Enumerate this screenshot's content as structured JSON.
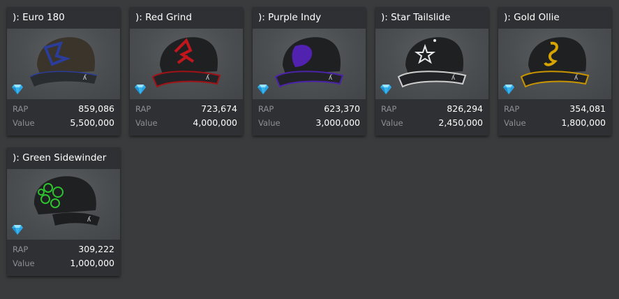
{
  "items": [
    {
      "name": "): Euro 180",
      "rap_label": "RAP",
      "rap": "859,086",
      "value_label": "Value",
      "value": "5,500,000",
      "accent": "#2b3d9a",
      "brim": "#2a2d30",
      "crown": "#3a342a",
      "icon": "diamond-icon"
    },
    {
      "name": "): Red Grind",
      "rap_label": "RAP",
      "rap": "723,674",
      "value_label": "Value",
      "value": "4,000,000",
      "accent": "#c0161c",
      "brim": "#a01216",
      "crown": "#1f2022",
      "icon": "diamond-icon"
    },
    {
      "name": "): Purple Indy",
      "rap_label": "RAP",
      "rap": "623,370",
      "value_label": "Value",
      "value": "3,000,000",
      "accent": "#5a22c8",
      "brim": "#4b23a8",
      "crown": "#1f2022",
      "icon": "diamond-icon"
    },
    {
      "name": "): Star Tailslide",
      "rap_label": "RAP",
      "rap": "826,294",
      "value_label": "Value",
      "value": "2,450,000",
      "accent": "#e8e8e8",
      "brim": "#cfcfcf",
      "crown": "#1f2022",
      "icon": "diamond-icon"
    },
    {
      "name": "): Gold Ollie",
      "rap_label": "RAP",
      "rap": "354,081",
      "value_label": "Value",
      "value": "1,800,000",
      "accent": "#d6a400",
      "brim": "#c89400",
      "crown": "#1f2022",
      "icon": "diamond-icon"
    },
    {
      "name": "): Green Sidewinder",
      "rap_label": "RAP",
      "rap": "309,222",
      "value_label": "Value",
      "value": "1,000,000",
      "accent": "#2ec22e",
      "brim": "#1d1e20",
      "crown": "#1f2022",
      "icon": "diamond-icon"
    }
  ]
}
